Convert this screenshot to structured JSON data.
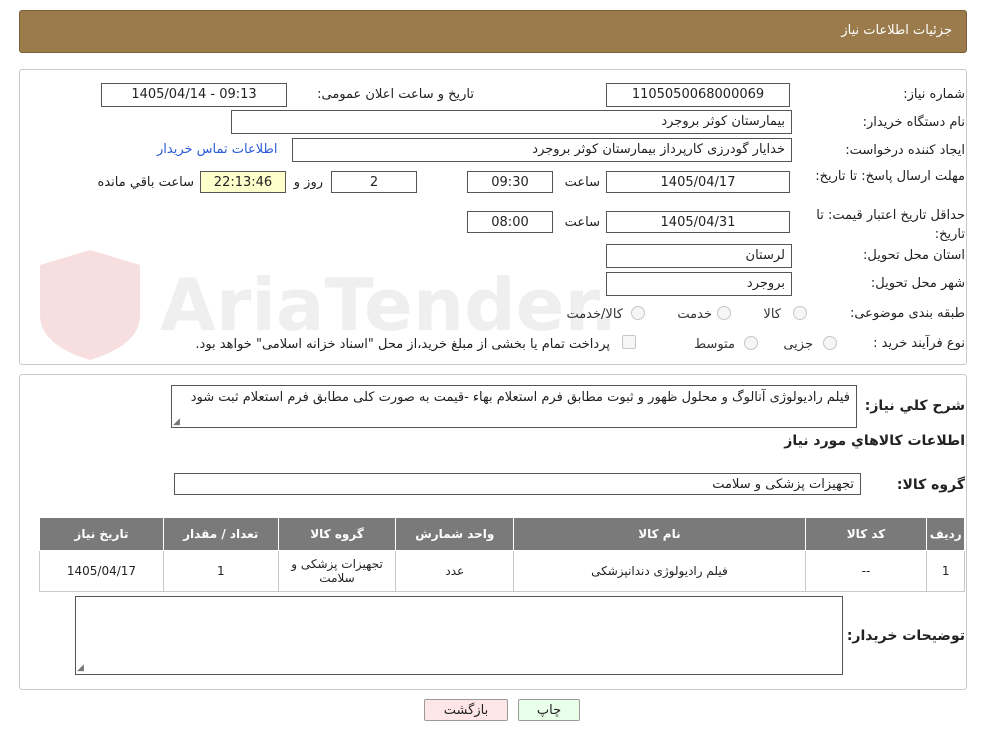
{
  "header": {
    "title": "جزئیات اطلاعات نیاز"
  },
  "form": {
    "need_number_label": "شماره نیاز:",
    "need_number": "1105050068000069",
    "announce_label": "تاریخ و ساعت اعلان عمومی:",
    "announce_value": "1405/04/14 - 09:13",
    "buyer_org_label": "نام دستگاه خریدار:",
    "buyer_org": "بیمارستان کوثر بروجرد",
    "requester_label": "ایجاد کننده درخواست:",
    "requester": "خدایار  گودرزی کارپرداز بیمارستان کوثر بروجرد",
    "contact_link": "اطلاعات تماس خریدار",
    "deadline_label": "مهلت ارسال پاسخ: تا تاریخ:",
    "deadline_date": "1405/04/17",
    "time_label": "ساعت",
    "deadline_time": "09:30",
    "days_value": "2",
    "days_label": "روز و",
    "remaining_time": "22:13:46",
    "remaining_label": "ساعت باقي مانده",
    "validity_label": "حداقل تاریخ اعتبار قیمت: تا تاریخ:",
    "validity_date": "1405/04/31",
    "validity_time_label": "ساعت",
    "validity_time": "08:00",
    "province_label": "استان محل تحویل:",
    "province": "لرستان",
    "city_label": "شهر محل تحویل:",
    "city": "بروجرد",
    "category_label": "طبقه بندی موضوعی:",
    "category_options": [
      "کالا",
      "خدمت",
      "کالا/خدمت"
    ],
    "process_label": "نوع فرآیند خرید :",
    "process_options": [
      "جزیی",
      "متوسط"
    ],
    "process_note": "پرداخت تمام یا بخشی از مبلغ خرید،از محل \"اسناد خزانه اسلامی\" خواهد بود."
  },
  "details": {
    "summary_label": "شرح کلي نياز:",
    "summary_text": "فیلم رادیولوژی آنالوگ و محلول ظهور و ثبوت مطابق فرم استعلام بهاء -قیمت به صورت کلی مطابق فرم استعلام ثبت شود",
    "goods_info_title": "اطلاعات کالاهاي مورد نياز",
    "goods_group_label": "گروه کالا:",
    "goods_group": "تجهیزات پزشکی و سلامت"
  },
  "table": {
    "headers": [
      "رديف",
      "کد کالا",
      "نام کالا",
      "واحد شمارش",
      "گروه کالا",
      "تعداد / مقدار",
      "تاریخ نیاز"
    ],
    "rows": [
      [
        "1",
        "--",
        "فیلم رادیولوژی دندانپزشکی",
        "عدد",
        "تجهیزات پزشکی و سلامت",
        "1",
        "1405/04/17"
      ]
    ]
  },
  "buyer_notes": {
    "label": "توضیحات خریدار:",
    "value": ""
  },
  "buttons": {
    "print": "چاپ",
    "back": "بازگشت"
  },
  "watermark": {
    "text": "AriaTender.neT"
  }
}
